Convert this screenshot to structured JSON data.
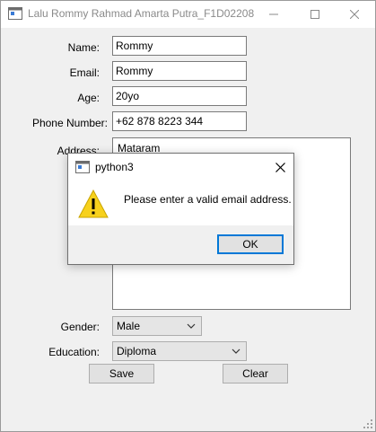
{
  "window": {
    "title": "Lalu Rommy Rahmad Amarta Putra_F1D02208"
  },
  "form": {
    "name_label": "Name:",
    "name_value": "Rommy",
    "email_label": "Email:",
    "email_value": "Rommy",
    "age_label": "Age:",
    "age_value": "20yo",
    "phone_label": "Phone Number:",
    "phone_value": "+62 878 8223 344",
    "address_label": "Address:",
    "address_value": "Mataram",
    "gender_label": "Gender:",
    "gender_value": "Male",
    "education_label": "Education:",
    "education_value": "Diploma",
    "save_label": "Save",
    "clear_label": "Clear"
  },
  "dialog": {
    "title": "python3",
    "message": "Please enter a valid email address.",
    "ok_label": "OK"
  },
  "colors": {
    "focus_border": "#0078d7",
    "warning_yellow": "#f7d11c"
  },
  "icons": [
    "app-icon",
    "minimize-icon",
    "maximize-icon",
    "close-icon",
    "warning-icon",
    "chevron-down-icon",
    "resize-grip-icon"
  ]
}
